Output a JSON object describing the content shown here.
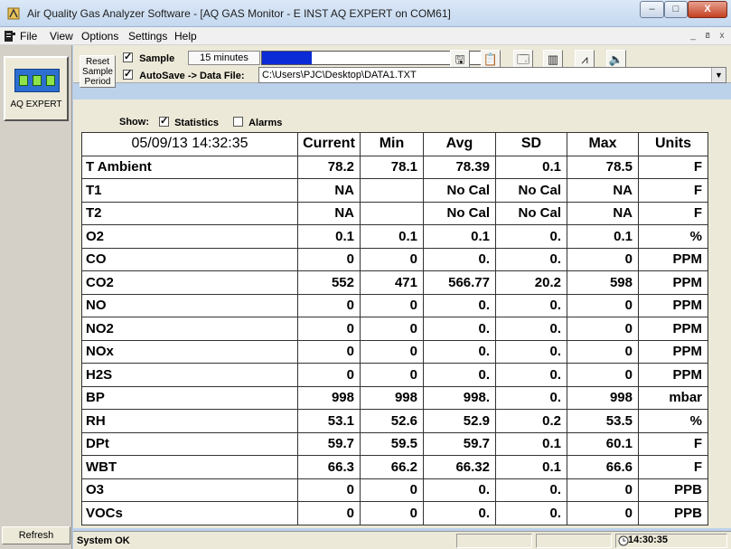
{
  "window": {
    "title": "Air Quality Gas Analyzer Software - [AQ GAS Monitor - E INST AQ EXPERT on COM61]",
    "minimize": "–",
    "maximize": "□",
    "close": "X"
  },
  "menu": {
    "items": [
      "File",
      "View",
      "Options",
      "Settings",
      "Help"
    ],
    "mdi_buttons": [
      "_",
      "ฮ",
      "x"
    ]
  },
  "sidebar": {
    "device_label": "AQ EXPERT",
    "refresh_label": "Refresh"
  },
  "toolbar": {
    "reset_label_1": "Reset",
    "reset_label_2": "Sample",
    "reset_label_3": "Period",
    "sample_label": "Sample",
    "sample_checked": true,
    "period_value": "15 minutes",
    "progress_fraction": 0.22,
    "autosave_label": "AutoSave ->  Data File:",
    "autosave_checked": true,
    "data_file": "C:\\Users\\PJC\\Desktop\\DATA1.TXT",
    "icons": [
      "save-icon",
      "clipboard-icon",
      "properties-icon",
      "bar-chart-icon",
      "line-chart-icon",
      "speaker-icon"
    ],
    "icon_glyphs": [
      "🖫",
      "📋",
      "🗔",
      "▥",
      "⩘",
      "🔈"
    ]
  },
  "show": {
    "label": "Show:",
    "statistics_label": "Statistics",
    "statistics_checked": true,
    "alarms_label": "Alarms",
    "alarms_checked": false
  },
  "table": {
    "timestamp": "05/09/13 14:32:35",
    "headers": [
      "Current",
      "Min",
      "Avg",
      "SD",
      "Max",
      "Units"
    ],
    "rows": [
      [
        "T Ambient",
        "78.2",
        "78.1",
        "78.39",
        "0.1",
        "78.5",
        "F"
      ],
      [
        "T1",
        "NA",
        "",
        "No Cal",
        "No Cal",
        "NA",
        "F"
      ],
      [
        "T2",
        "NA",
        "",
        "No Cal",
        "No Cal",
        "NA",
        "F"
      ],
      [
        "O2",
        "0.1",
        "0.1",
        "0.1",
        "0.",
        "0.1",
        "%"
      ],
      [
        "CO",
        "0",
        "0",
        "0.",
        "0.",
        "0",
        "PPM"
      ],
      [
        "CO2",
        "552",
        "471",
        "566.77",
        "20.2",
        "598",
        "PPM"
      ],
      [
        "NO",
        "0",
        "0",
        "0.",
        "0.",
        "0",
        "PPM"
      ],
      [
        "NO2",
        "0",
        "0",
        "0.",
        "0.",
        "0",
        "PPM"
      ],
      [
        "NOx",
        "0",
        "0",
        "0.",
        "0.",
        "0",
        "PPM"
      ],
      [
        "H2S",
        "0",
        "0",
        "0.",
        "0.",
        "0",
        "PPM"
      ],
      [
        "BP",
        "998",
        "998",
        "998.",
        "0.",
        "998",
        "mbar"
      ],
      [
        "RH",
        "53.1",
        "52.6",
        "52.9",
        "0.2",
        "53.5",
        "%"
      ],
      [
        "DPt",
        "59.7",
        "59.5",
        "59.7",
        "0.1",
        "60.1",
        "F"
      ],
      [
        "WBT",
        "66.3",
        "66.2",
        "66.32",
        "0.1",
        "66.6",
        "F"
      ],
      [
        "O3",
        "0",
        "0",
        "0.",
        "0.",
        "0",
        "PPB"
      ],
      [
        "VOCs",
        "0",
        "0",
        "0.",
        "0.",
        "0",
        "PPB"
      ]
    ]
  },
  "status": {
    "text": "System OK",
    "clock": "14:30:35"
  }
}
